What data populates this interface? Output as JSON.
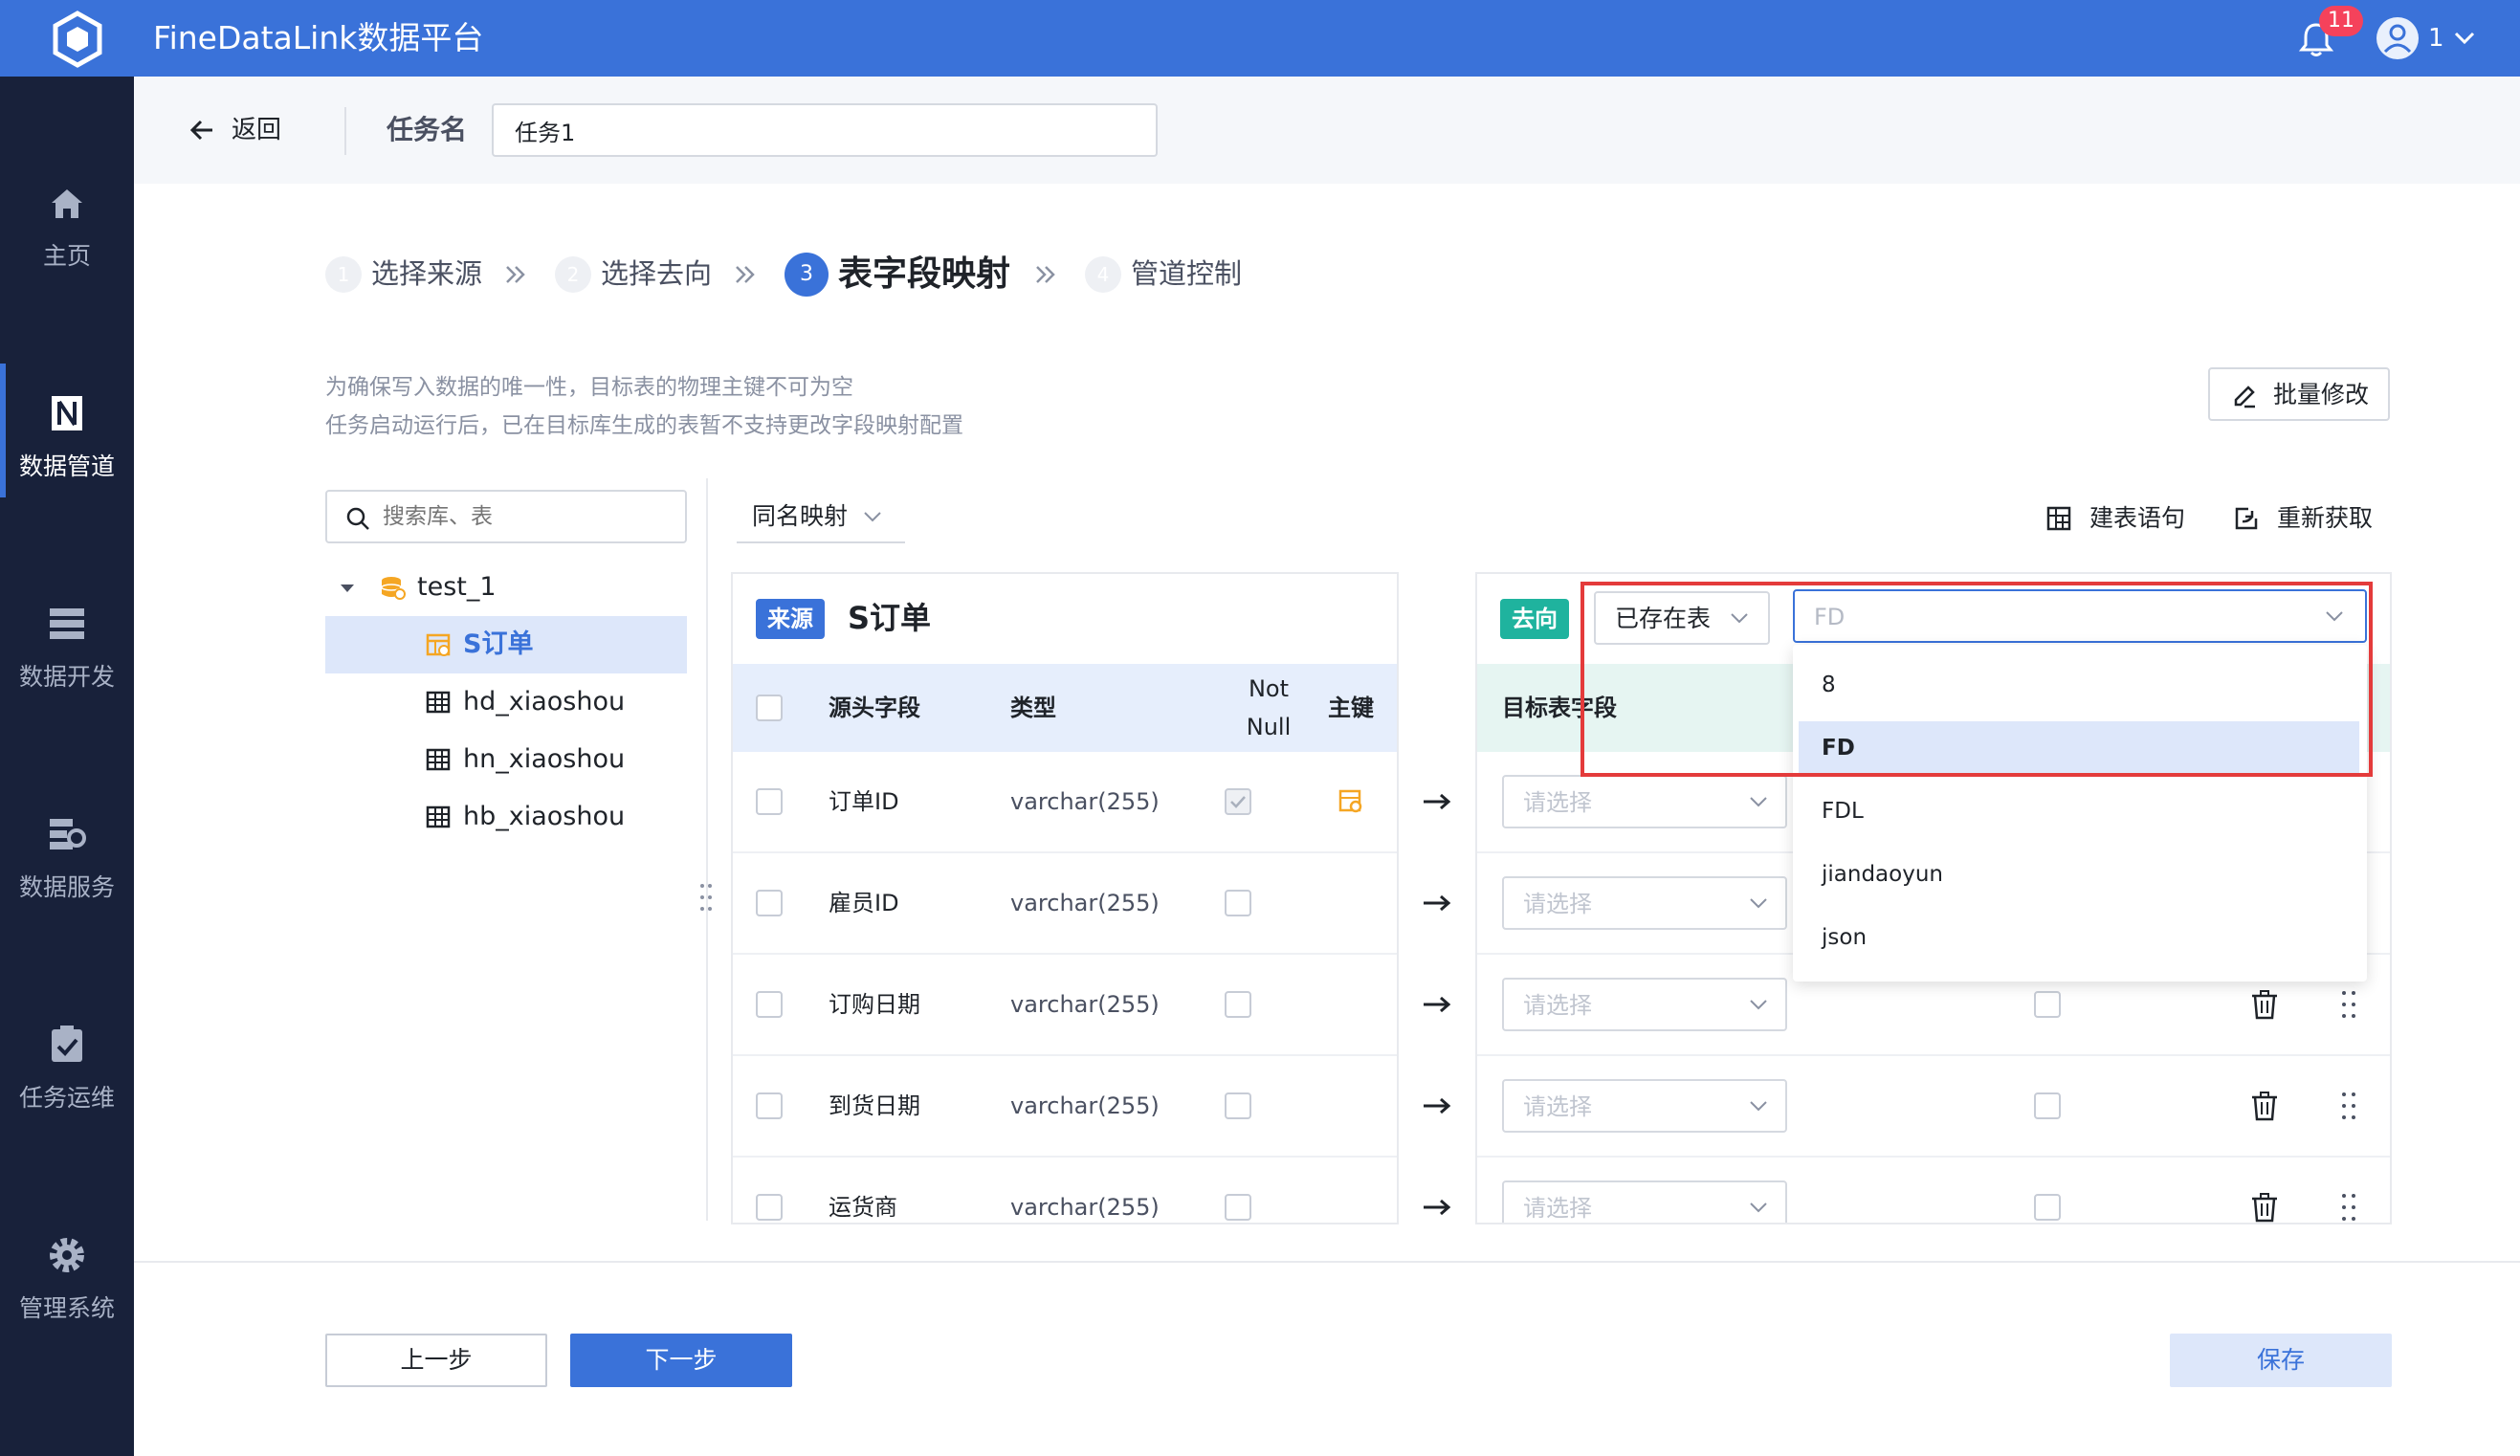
{
  "app": {
    "title": "FineDataLink数据平台",
    "notification_count": "11",
    "user_name": "1"
  },
  "sidebar": {
    "items": [
      {
        "label": "主页",
        "icon": "home-icon",
        "active": false
      },
      {
        "label": "数据管道",
        "icon": "pipeline-icon",
        "active": true
      },
      {
        "label": "数据开发",
        "icon": "dev-icon",
        "active": false
      },
      {
        "label": "数据服务",
        "icon": "service-icon",
        "active": false
      },
      {
        "label": "任务运维",
        "icon": "ops-icon",
        "active": false
      },
      {
        "label": "管理系统",
        "icon": "gear-icon",
        "active": false
      }
    ]
  },
  "header": {
    "back_label": "返回",
    "task_name_label": "任务名",
    "task_name_value": "任务1"
  },
  "steps": [
    {
      "num": "1",
      "label": "选择来源"
    },
    {
      "num": "2",
      "label": "选择去向"
    },
    {
      "num": "3",
      "label": "表字段映射"
    },
    {
      "num": "4",
      "label": "管道控制"
    }
  ],
  "notices": [
    "为确保写入数据的唯一性，目标表的物理主键不可为空",
    "任务启动运行后，已在目标库生成的表暂不支持更改字段映射配置"
  ],
  "batch_edit_label": "批量修改",
  "tree": {
    "search_placeholder": "搜索库、表",
    "db_name": "test_1",
    "tables": [
      "S订单",
      "hd_xiaoshou",
      "hn_xiaoshou",
      "hb_xiaoshou"
    ]
  },
  "mapping_mode": "同名映射",
  "toolbar": {
    "ddl_label": "建表语句",
    "refetch_label": "重新获取"
  },
  "source": {
    "badge": "来源",
    "table_name": "S订单",
    "headers": {
      "field": "源头字段",
      "type": "类型",
      "not_null_line1": "Not",
      "not_null_line2": "Null",
      "pk": "主键"
    },
    "rows": [
      {
        "field": "订单ID",
        "type": "varchar(255)"
      },
      {
        "field": "雇员ID",
        "type": "varchar(255)"
      },
      {
        "field": "订购日期",
        "type": "varchar(255)"
      },
      {
        "field": "到货日期",
        "type": "varchar(255)"
      },
      {
        "field": "运货商",
        "type": "varchar(255)"
      }
    ]
  },
  "target": {
    "badge": "去向",
    "table_mode": "已存在表",
    "table_select_value": "FD",
    "field_header": "目标表字段",
    "field_placeholder": "请选择",
    "dropdown_options": [
      "8",
      "FD",
      "FDL",
      "jiandaoyun",
      "json"
    ],
    "selected_option": "FD"
  },
  "footer": {
    "prev_label": "上一步",
    "next_label": "下一步",
    "save_label": "保存"
  },
  "colors": {
    "primary": "#3a72d9",
    "sidebar": "#18213a",
    "target_badge": "#1fb39e",
    "highlight": "#e43b3b"
  }
}
